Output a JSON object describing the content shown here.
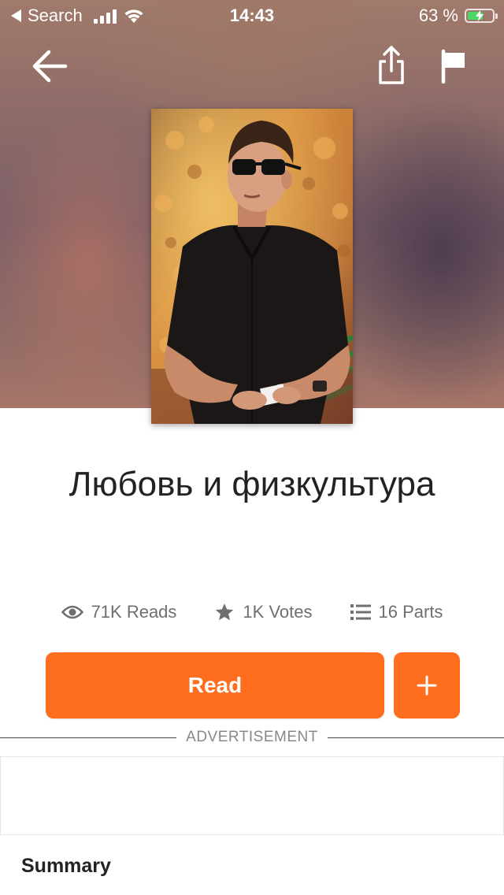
{
  "status_bar": {
    "back_app": "Search",
    "time": "14:43",
    "battery_percent": "63 %",
    "battery_level": 0.63
  },
  "nav": {
    "back_icon": "arrow-left-icon",
    "share_icon": "share-icon",
    "report_icon": "flag-icon"
  },
  "story": {
    "title": "Любовь и физкультура",
    "cover_description_icon": "cover-image"
  },
  "stats": {
    "reads": "71K Reads",
    "votes": "1K Votes",
    "parts": "16 Parts"
  },
  "actions": {
    "read_label": "Read",
    "add_label": "+"
  },
  "advertisement": {
    "label": "ADVERTISEMENT"
  },
  "summary": {
    "heading": "Summary"
  },
  "colors": {
    "accent": "#ff6d1f",
    "stat_text": "#6f6f6f",
    "title_text": "#222222"
  }
}
